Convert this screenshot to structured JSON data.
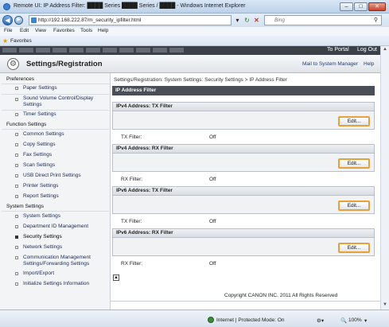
{
  "window": {
    "title": "Remote UI: IP Address Filter: ████ Series ████ Series / ████ - Windows Internet Explorer",
    "min": "–",
    "max": "□",
    "close": "✕"
  },
  "address": {
    "url": "http://192.168.222.87/m_security_ipfilter.html",
    "search_placeholder": "Bing",
    "back": "◀",
    "forward": "▶",
    "dropdown": "▾",
    "refresh": "↻",
    "stop": "✕"
  },
  "menu": {
    "items": [
      "File",
      "Edit",
      "View",
      "Favorites",
      "Tools",
      "Help"
    ]
  },
  "favorites": {
    "label": "Favorites"
  },
  "header": {
    "portal": "To Portal",
    "logout": "Log Out",
    "title": "Settings/Registration",
    "mail": "Mail to System Manager",
    "help": "Help"
  },
  "sidebar": {
    "preferences": "Preferences",
    "pref_items": [
      "Paper Settings",
      "Sound Volume Control/Display Settings",
      "Timer Settings"
    ],
    "function": "Function Settings",
    "func_items": [
      "Common Settings",
      "Copy Settings",
      "Fax Settings",
      "Scan Settings",
      "USB Direct Print Settings",
      "Printer Settings",
      "Report Settings"
    ],
    "system": "System Settings",
    "sys_items": [
      "System Settings",
      "Department ID Management",
      "Security Settings",
      "Network Settings",
      "Communication Management Settings/Forwarding Settings",
      "Import/Export",
      "Initialize Settings Information"
    ]
  },
  "main": {
    "breadcrumb": "Settings/Registration: System Settings: Security Settings > IP Address Filter",
    "panel_title": "IP Address Filter",
    "sections": [
      {
        "title": "IPv4 Address: TX Filter",
        "label": "TX Filter:",
        "value": "Off",
        "edit": "Edit..."
      },
      {
        "title": "IPv4 Address: RX Filter",
        "label": "RX Filter:",
        "value": "Off",
        "edit": "Edit..."
      },
      {
        "title": "IPv6 Address: TX Filter",
        "label": "TX Filter:",
        "value": "Off",
        "edit": "Edit..."
      },
      {
        "title": "IPv6 Address: RX Filter",
        "label": "RX Filter:",
        "value": "Off",
        "edit": "Edit..."
      }
    ],
    "copyright": "Copyright CANON INC. 2011 All Rights Reserved"
  },
  "status": {
    "zone": "Internet | Protected Mode: On",
    "zoom": "100%",
    "zoom_arrow": "▾"
  }
}
